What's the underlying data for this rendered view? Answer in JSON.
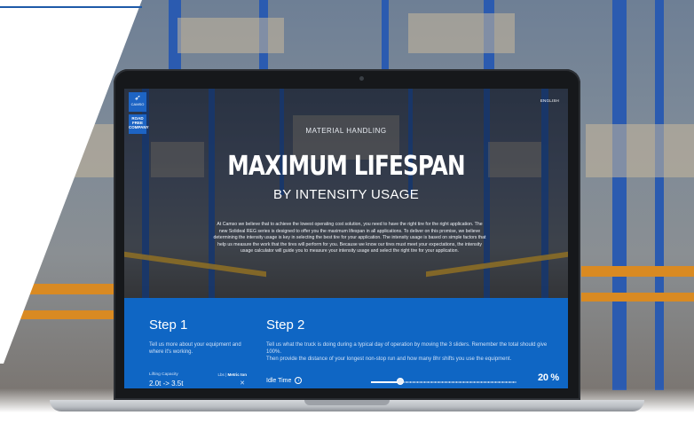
{
  "screen": {
    "brand": {
      "logo_text": "CAMSO",
      "roadfree_text": "ROAD FREE COMPANY"
    },
    "language": "ENGLISH",
    "kicker": "MATERIAL HANDLING",
    "headline": "MAXIMUM LIFESPAN",
    "subhead": "BY INTENSITY USAGE",
    "intro": "At Camso we believe that to achieve the lowest operating cost solution, you need to have the right tire for the right application. The new Solideal REG series is designed to offer you the maximum lifespan in all applications. To deliver on this promise, we believe determining the intensity usage is key in selecting the best tire for your application. The intensity usage is based on simple factors that help us measure the work that the tires will perform for you. Because we know our tires must meet your expectations, the intensity usage calculator will guide you to measure your intensity usage and select the right tire for your application.",
    "step1": {
      "title": "Step 1",
      "text": "Tell us more about your equipment and where it's working.",
      "lifting_label": "Lifting Capacity",
      "unit_lbs": "Lbs",
      "unit_metric": "Metric ton",
      "lifting_value": "2.0t -> 3.5t"
    },
    "step2": {
      "title": "Step 2",
      "text1": "Tell us what the truck is doing during a typical day of operation by moving the 3 sliders. Remember the total should give 100%.",
      "text2": "Then provide the distance of your longest non-stop run and how many 8hr shifts you use the equipment.",
      "idle_label": "Idle Time",
      "idle_value": "20 %",
      "idle_fraction": 0.2
    }
  },
  "colors": {
    "accent": "#0f66c4",
    "brand": "#1d64c4"
  },
  "icons": {
    "info": "info-icon",
    "select_arrow": "chevron-down-icon"
  }
}
